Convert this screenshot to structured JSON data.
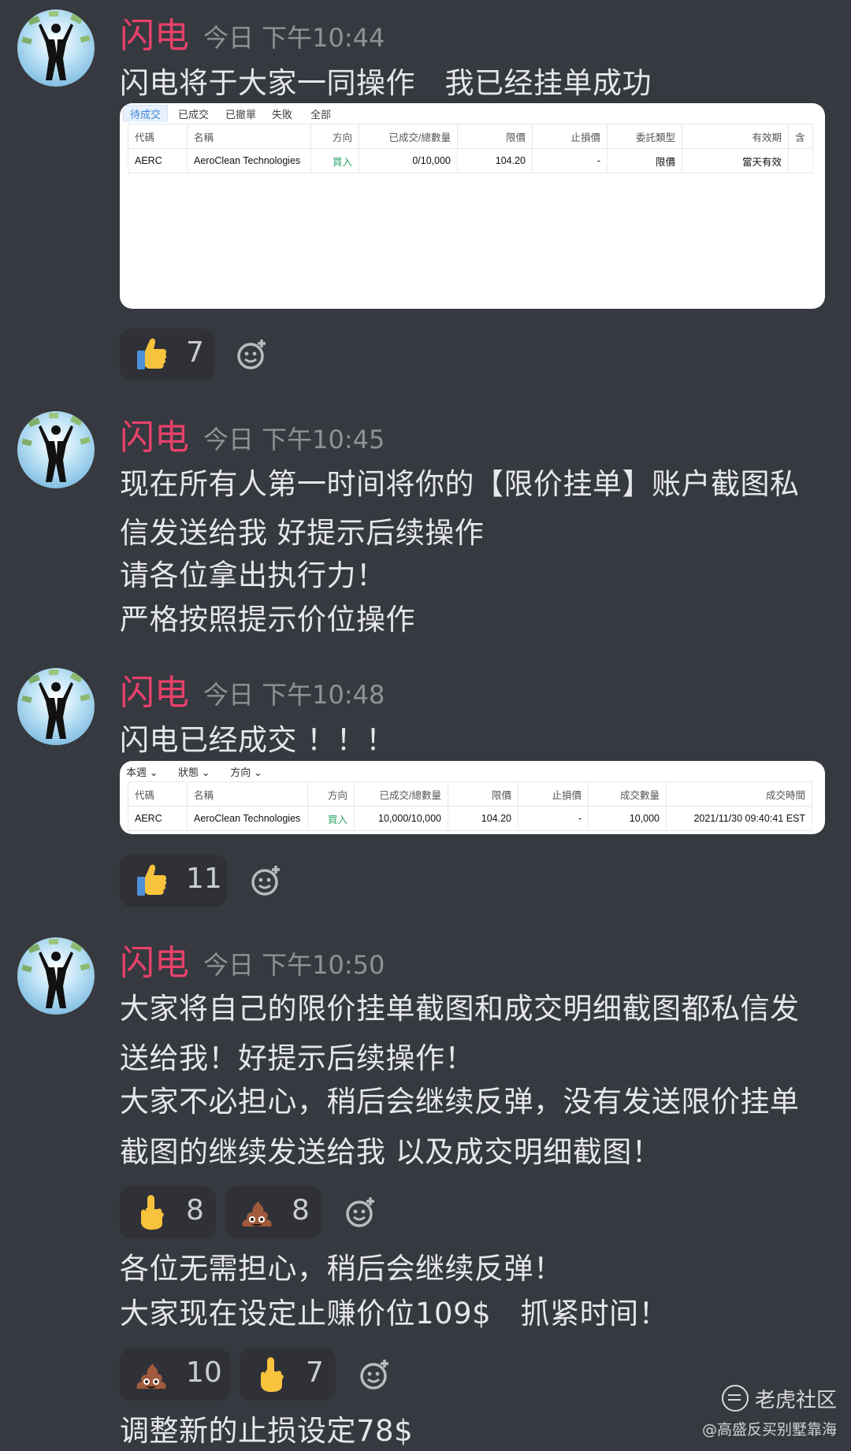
{
  "messages": [
    {
      "author": "闪电",
      "time": "今日 下午10:44",
      "lines": [
        "闪电将于大家一同操作　我已经挂单成功"
      ],
      "screenshot": {
        "tabs": [
          "待成交",
          "已成交",
          "已撤單",
          "失敗",
          "全部"
        ],
        "headers": [
          "代碼",
          "名稱",
          "方向",
          "已成交/總數量",
          "限價",
          "止損價",
          "委託類型",
          "有效期",
          "含"
        ],
        "row": [
          "AERC",
          "AeroClean Technologies",
          "買入",
          "0/10,000",
          "104.20",
          "-",
          "限價",
          "當天有效",
          ""
        ]
      },
      "reactions": [
        {
          "emoji": "thumbs-up",
          "count": "7"
        }
      ]
    },
    {
      "author": "闪电",
      "time": "今日 下午10:45",
      "lines": [
        "现在所有人第一时间将你的【限价挂单】账户截图私",
        "信发送给我 好提示后续操作",
        "请各位拿出执行力！",
        "严格按照提示价位操作"
      ]
    },
    {
      "author": "闪电",
      "time": "今日 下午10:48",
      "lines": [
        "闪电已经成交 ！！！"
      ],
      "screenshot": {
        "filters": [
          "本週 ⌄",
          "狀態 ⌄",
          "方向 ⌄"
        ],
        "headers": [
          "代碼",
          "名稱",
          "方向",
          "已成交/總數量",
          "限價",
          "止損價",
          "成交數量",
          "成交時間"
        ],
        "row": [
          "AERC",
          "AeroClean Technologies",
          "買入",
          "10,000/10,000",
          "104.20",
          "-",
          "10,000",
          "2021/11/30 09:40:41 EST"
        ]
      },
      "reactions": [
        {
          "emoji": "thumbs-up",
          "count": "11"
        }
      ]
    },
    {
      "author": "闪电",
      "time": "今日 下午10:50",
      "lines": [
        "大家将自己的限价挂单截图和成交明细截图都私信发",
        "送给我！好提示后续操作！",
        "大家不必担心，稍后会继续反弹，没有发送限价挂单",
        "截图的继续发送给我 以及成交明细截图！"
      ],
      "reactions": [
        {
          "emoji": "middle-finger",
          "count": "8"
        },
        {
          "emoji": "pile-of-poo",
          "count": "8"
        }
      ],
      "lines2": [
        "各位无需担心，稍后会继续反弹！",
        "大家现在设定止赚价位109$　抓紧时间！"
      ],
      "reactions2": [
        {
          "emoji": "pile-of-poo",
          "count": "10"
        },
        {
          "emoji": "middle-finger",
          "count": "7"
        }
      ],
      "lines3": [
        "调整新的止损设定78$"
      ]
    }
  ],
  "watermark": {
    "logo": "老虎社区",
    "sub": "@高盛反买别墅靠海"
  },
  "colors": {
    "background": "#36393f",
    "author": "#e8416b",
    "timestamp": "#8e9297",
    "reaction_bg": "#2f3136",
    "buy_text": "#2ea56a"
  }
}
